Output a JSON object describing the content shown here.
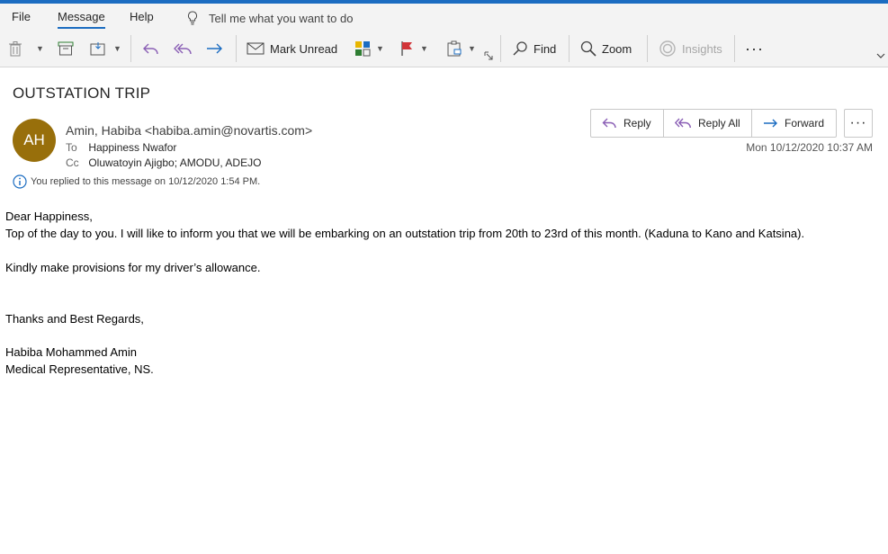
{
  "menu": {
    "file": "File",
    "message": "Message",
    "help": "Help",
    "tell_me": "Tell me what you want to do"
  },
  "toolbar": {
    "mark_unread": "Mark Unread",
    "find": "Find",
    "zoom": "Zoom",
    "insights": "Insights",
    "more": "···"
  },
  "message": {
    "subject": "OUTSTATION TRIP",
    "avatar_initials": "AH",
    "avatar_color": "#986f0b",
    "sender": "Amin, Habiba <habiba.amin@novartis.com>",
    "to_label": "To",
    "to": "Happiness Nwafor",
    "cc_label": "Cc",
    "cc": "Oluwatoyin Ajigbo; AMODU, ADEJO",
    "replied_notice": "You replied to this message on 10/12/2020 1:54 PM.",
    "datetime": "Mon 10/12/2020 10:37 AM"
  },
  "actions": {
    "reply": "Reply",
    "reply_all": "Reply All",
    "forward": "Forward",
    "more": "···"
  },
  "body": {
    "greeting": "Dear Happiness,",
    "line1": "Top of the day to you. I will like to inform you that we will be embarking on an outstation trip from 20th to 23rd of this month. (Kaduna to Kano and Katsina).",
    "line2": "Kindly make provisions for my driver’s allowance.",
    "closing": "Thanks and Best Regards,",
    "sig_name": "Habiba Mohammed Amin",
    "sig_title": "Medical Representative, NS."
  },
  "colors": {
    "accent": "#1b6cc1",
    "reply_arrow": "#8a5fb5",
    "flag": "#d13438"
  }
}
